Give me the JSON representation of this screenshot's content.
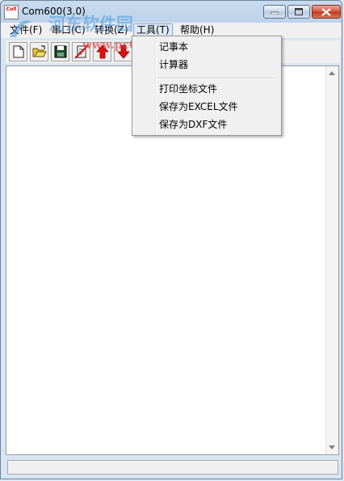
{
  "window": {
    "title": "Com600(3.0)",
    "icon_text": "Coll"
  },
  "menubar": {
    "items": [
      "文件(F)",
      "串口(C)",
      "转换(Z)",
      "工具(T)",
      "帮助(H)"
    ]
  },
  "toolbar": {
    "buttons": [
      "new-file-icon",
      "open-folder-icon",
      "save-disk-icon",
      "clear-icon",
      "upload-arrow-icon",
      "download-arrow-icon"
    ]
  },
  "tools_menu": {
    "items": [
      "记事本",
      "计算器",
      "打印坐标文件",
      "保存为EXCEL文件",
      "保存为DXF文件"
    ]
  },
  "watermark": {
    "text": "河东软件园",
    "url": "www.pc0359.cn"
  },
  "colors": {
    "title_gradient_top": "#c9dbef",
    "close_button": "#c0351c",
    "arrow_red": "#e01010"
  }
}
